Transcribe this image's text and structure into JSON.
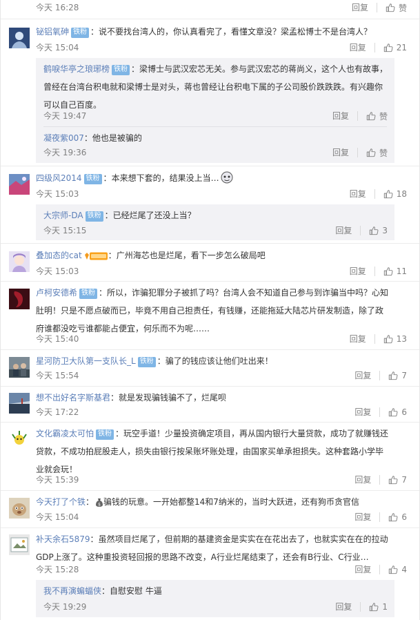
{
  "common": {
    "reply_label": "回复",
    "badge_label": "铁粉",
    "like_label": "赞"
  },
  "comments": [
    {
      "time": "今天 16:28",
      "likes": "赞"
    },
    {
      "user": "铋铝氧砷",
      "text": "说不要找台湾人的，你认真看完了，看懂文章没？梁孟松博士不是台湾人？",
      "time": "今天 15:04",
      "likes": "21"
    },
    {
      "user": "鹤唳华亭之琅琊榜",
      "text": "梁博士与武汉宏芯无关。参与武汉宏芯的蒋尚义，这个人也有故事，曾经在台湾台积电就和梁博士是对头，蒋也曾经让台积电下属的子公司股价跌跌跌。有兴趣你可以自己百度。",
      "time": "今天 19:47",
      "likes": "赞"
    },
    {
      "user": "凝夜紫007",
      "text": "他也是被骗的",
      "time": "今天 19:36",
      "likes": "赞"
    },
    {
      "user": "四级风2014",
      "text": "本来想下套的，结果没上当…",
      "time": "今天 15:03",
      "likes": "18"
    },
    {
      "user": "大宗师-DA",
      "text": "已经烂尾了还没上当？",
      "time": "今天 15:15",
      "likes": "3"
    },
    {
      "user": "叠加态的cat",
      "text": "广州海芯也是烂尾，看下一步怎么破局吧",
      "time": "今天 15:03",
      "likes": "11"
    },
    {
      "user": "卢柯安德希",
      "text": "所以，诈骗犯罪分子被抓了吗？台湾人会不知道自己参与到诈骗当中吗？心知肚明！只是不愿点破而已，毕竟不用自己担责任，有钱赚，还能拖延大陆芯片研发制造，除了政府谁都没吃亏谁都能占便宜，何乐而不为呢……",
      "time": "今天 15:40",
      "likes": "13"
    },
    {
      "user": "星河防卫大队第一支队长_L",
      "text": "骗了的钱应该让他们吐出来！",
      "time": "今天 15:54",
      "likes": "7"
    },
    {
      "user": "想不出好名字斯基君",
      "text": "就是发现骗钱骗不了，烂尾呗",
      "time": "今天 17:22",
      "likes": "6"
    },
    {
      "user": "文化霸凌太可怕",
      "text": "玩空手道！少量投资确定项目，再从国内银行大量贷款，成功了就赚钱还贷款，不成功拍屁股走人，损失由银行按呆账坏账处理，由国家买单承担损失。这种套路小学毕业就会玩！",
      "time": "今天 15:39",
      "likes": "7"
    },
    {
      "user": "今天打了个铁",
      "text": "骗钱的玩意。一开始都整14和7纳米的，当时大跃进，还有狗币贪官信",
      "time": "今天 15:04",
      "likes": "6"
    },
    {
      "user": "补天余石5879",
      "text": "虽然项目烂尾了，但前期的基建资金是实实在在花出去了，也就实实在在的拉动GDP上涨了。这种重投资轻回报的思路不改变，A行业烂尾结束了，还会有B行业、C行业…",
      "time": "今天 15:28",
      "likes": "4"
    },
    {
      "user": "我不再演蝙蝠侠",
      "text": "自慰安慰 牛逼",
      "time": "今天 19:29",
      "likes": "1"
    }
  ]
}
